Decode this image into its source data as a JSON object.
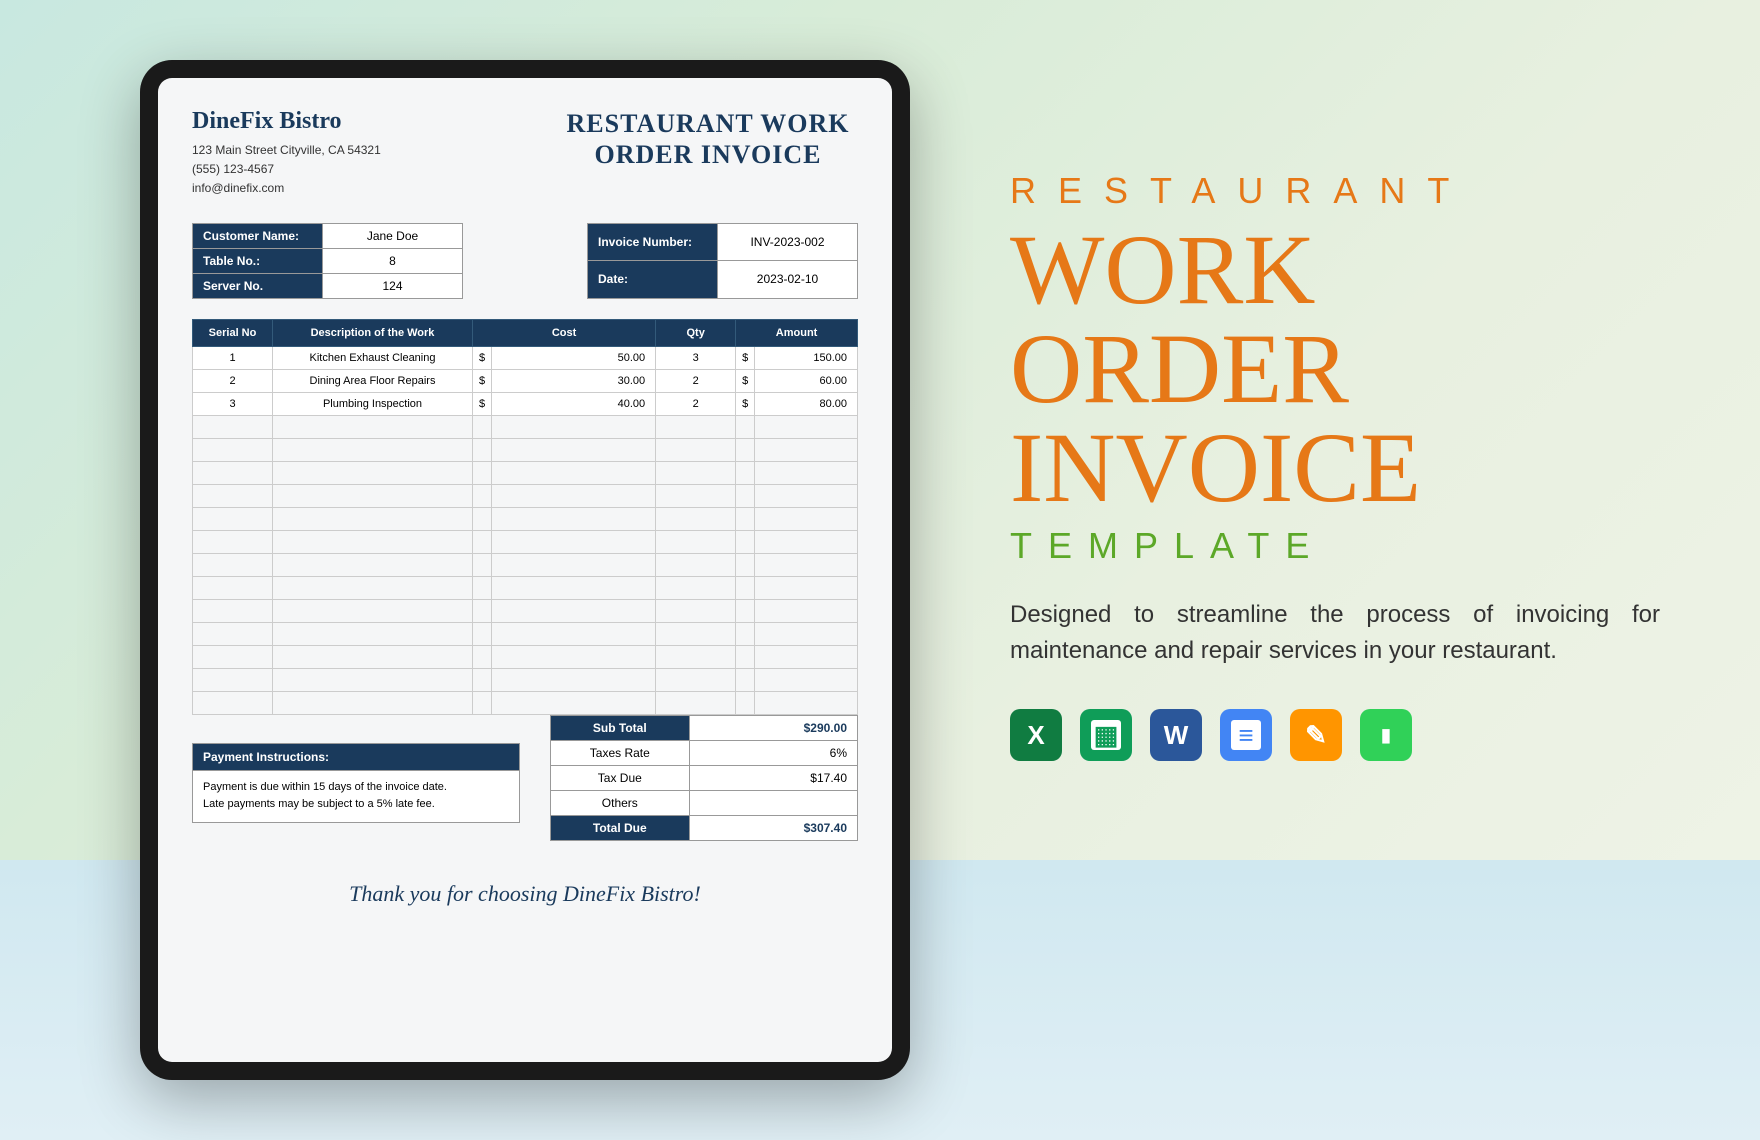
{
  "company": {
    "name": "DineFix Bistro",
    "address": "123 Main Street Cityville, CA 54321",
    "phone": "(555) 123-4567",
    "email": "info@dinefix.com"
  },
  "doc_title_line1": "Restaurant Work",
  "doc_title_line2": "Order Invoice",
  "customer_info": {
    "labels": {
      "name": "Customer Name:",
      "table": "Table No.:",
      "server": "Server No."
    },
    "values": {
      "name": "Jane Doe",
      "table": "8",
      "server": "124"
    }
  },
  "invoice_info": {
    "labels": {
      "number": "Invoice Number:",
      "date": "Date:"
    },
    "values": {
      "number": "INV-2023-002",
      "date": "2023-02-10"
    }
  },
  "work_headers": {
    "serial": "Serial No",
    "desc": "Description of the Work",
    "cost": "Cost",
    "qty": "Qty",
    "amount": "Amount"
  },
  "work_items": [
    {
      "serial": "1",
      "desc": "Kitchen Exhaust Cleaning",
      "cost": "50.00",
      "qty": "3",
      "amount": "150.00"
    },
    {
      "serial": "2",
      "desc": "Dining Area Floor Repairs",
      "cost": "30.00",
      "qty": "2",
      "amount": "60.00"
    },
    {
      "serial": "3",
      "desc": "Plumbing Inspection",
      "cost": "40.00",
      "qty": "2",
      "amount": "80.00"
    }
  ],
  "dollar": "$",
  "payment": {
    "header": "Payment Instructions:",
    "line1": "Payment is due within 15 days of the invoice date.",
    "line2": "Late payments may be subject to a 5% late fee."
  },
  "totals": {
    "subtotal_label": "Sub Total",
    "subtotal": "$290.00",
    "taxrate_label": "Taxes Rate",
    "taxrate": "6%",
    "taxdue_label": "Tax Due",
    "taxdue": "$17.40",
    "others_label": "Others",
    "others": "",
    "totaldue_label": "Total Due",
    "totaldue": "$307.40"
  },
  "thanks": "Thank you for choosing DineFix Bistro!",
  "promo": {
    "restaurant": "RESTAURANT",
    "line1": "WORK",
    "line2": "ORDER",
    "line3": "INVOICE",
    "template": "TEMPLATE",
    "description": "Designed to streamline the process of invoicing for maintenance and repair services in your restaurant."
  },
  "app_icons": {
    "excel": "X",
    "sheets": "▦",
    "word": "W",
    "docs": "≡",
    "pages": "✎",
    "numbers": "▮"
  }
}
